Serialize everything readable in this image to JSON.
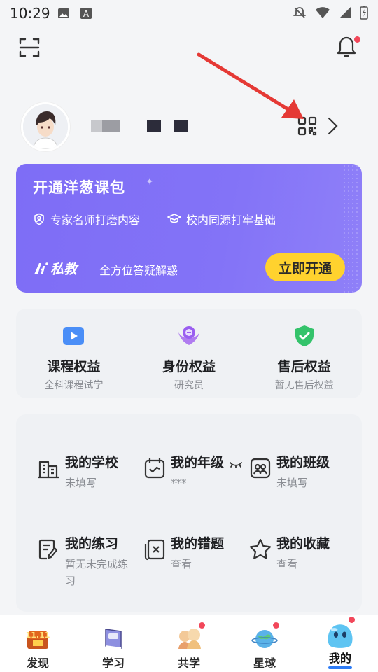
{
  "status_bar": {
    "time": "10:29",
    "left_icons": [
      "image-icon",
      "a-icon"
    ],
    "right_icons": [
      "bell-off-icon",
      "wifi-icon",
      "signal-icon",
      "battery-charging-icon"
    ]
  },
  "top_bar": {
    "scan_icon": "scan-icon",
    "bell_icon": "bell-icon",
    "bell_has_dot": true
  },
  "profile": {
    "avatar": "avatar-anime-boy",
    "qr_icon": "qr-code-icon",
    "chevron_icon": "chevron-right-icon"
  },
  "promo": {
    "title": "开通洋葱课包",
    "features": [
      {
        "icon": "expert-badge-icon",
        "label": "专家名师打磨内容"
      },
      {
        "icon": "graduation-cap-icon",
        "label": "校内同源打牢基础"
      }
    ],
    "logo_text": "私教",
    "subtitle": "全方位答疑解惑",
    "cta_label": "立即开通",
    "colors": {
      "bg": "#7e6df6",
      "cta": "#ffd22e"
    }
  },
  "benefits": [
    {
      "title": "课程权益",
      "subtitle": "全科课程试学",
      "icon": "play-icon"
    },
    {
      "title": "身份权益",
      "subtitle": "研究员",
      "icon": "badge-icon"
    },
    {
      "title": "售后权益",
      "subtitle": "暂无售后权益",
      "icon": "shield-check-icon"
    }
  ],
  "info_grid": [
    {
      "title": "我的学校",
      "subtitle": "未填写",
      "icon": "school-icon"
    },
    {
      "title": "我的年级",
      "subtitle": "***",
      "icon": "calendar-icon",
      "eye_icon": "eye-closed-icon"
    },
    {
      "title": "我的班级",
      "subtitle": "未填写",
      "icon": "class-icon"
    },
    {
      "title": "我的练习",
      "subtitle": "暂无未完成练习",
      "icon": "practice-icon"
    },
    {
      "title": "我的错题",
      "subtitle": "查看",
      "icon": "wrong-question-icon"
    },
    {
      "title": "我的收藏",
      "subtitle": "查看",
      "icon": "star-icon"
    }
  ],
  "bottom_nav": [
    {
      "label": "发现",
      "icon": "discover-icon",
      "dot": false,
      "active": false
    },
    {
      "label": "学习",
      "icon": "study-book-icon",
      "dot": false,
      "active": false
    },
    {
      "label": "共学",
      "icon": "co-study-icon",
      "dot": true,
      "active": false
    },
    {
      "label": "星球",
      "icon": "planet-icon",
      "dot": true,
      "active": false
    },
    {
      "label": "我的",
      "icon": "me-blob-icon",
      "dot": true,
      "active": true
    }
  ],
  "colors": {
    "accent": "#2e7cf6",
    "red_dot": "#f2475a",
    "annotation": "#e53935"
  }
}
